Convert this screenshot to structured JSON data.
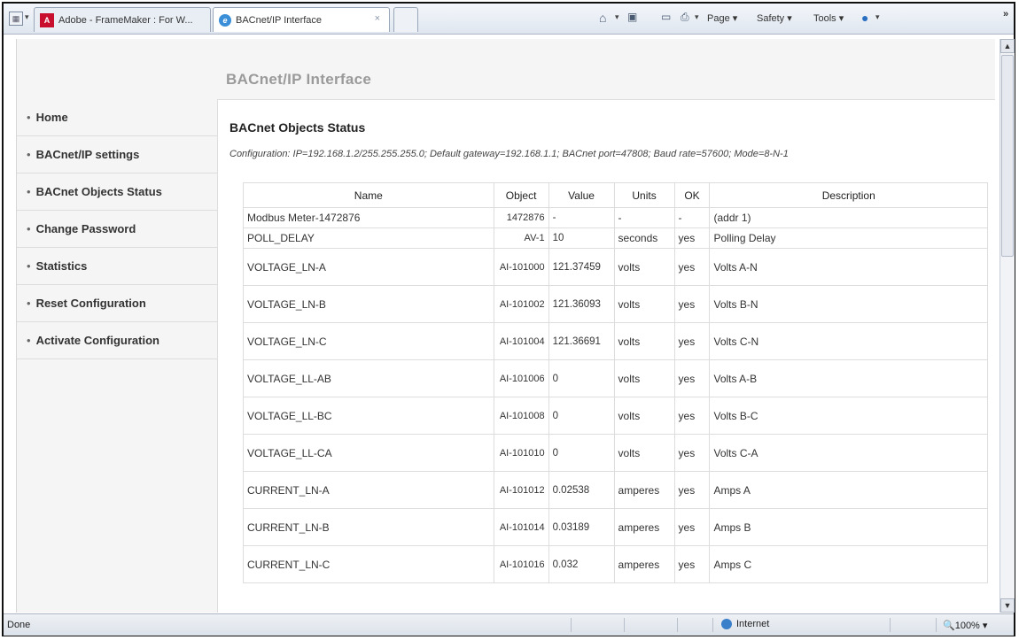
{
  "browser": {
    "tabs": [
      {
        "label": "Adobe - FrameMaker : For W..."
      },
      {
        "label": "BACnet/IP Interface",
        "close": "×"
      }
    ],
    "tabs_menu_glyph": "▾",
    "overflow_glyph": "»",
    "commands": {
      "page": "Page",
      "safety": "Safety",
      "tools": "Tools",
      "dropdown_glyph": "▾"
    },
    "status": {
      "text": "Done",
      "zone": "Internet",
      "zoom": "100%"
    }
  },
  "header": {
    "title": "BACnet/IP Interface"
  },
  "sidebar": {
    "bullet": "•",
    "items": [
      {
        "label": "Home"
      },
      {
        "label": "BACnet/IP settings"
      },
      {
        "label": "BACnet Objects Status"
      },
      {
        "label": "Change Password"
      },
      {
        "label": "Statistics"
      },
      {
        "label": "Reset Configuration"
      },
      {
        "label": "Activate Configuration"
      }
    ]
  },
  "main": {
    "title": "BACnet Objects Status",
    "configuration": "Configuration: IP=192.168.1.2/255.255.255.0; Default gateway=192.168.1.1; BACnet port=47808; Baud rate=57600; Mode=8-N-1",
    "columns": [
      "Name",
      "Object",
      "Value",
      "Units",
      "OK",
      "Description"
    ],
    "rows": [
      {
        "name": "Modbus Meter-1472876",
        "object": "1472876",
        "value": "-",
        "units": "-",
        "ok": "-",
        "description": "(addr 1)"
      },
      {
        "name": "POLL_DELAY",
        "object": "AV-1",
        "value": "10",
        "units": "seconds",
        "ok": "yes",
        "description": "Polling Delay"
      },
      {
        "name": "VOLTAGE_LN-A",
        "object": "AI-101000",
        "value": "121.37459",
        "units": "volts",
        "ok": "yes",
        "description": "Volts A-N"
      },
      {
        "name": "VOLTAGE_LN-B",
        "object": "AI-101002",
        "value": "121.36093",
        "units": "volts",
        "ok": "yes",
        "description": "Volts B-N"
      },
      {
        "name": "VOLTAGE_LN-C",
        "object": "AI-101004",
        "value": "121.36691",
        "units": "volts",
        "ok": "yes",
        "description": "Volts C-N"
      },
      {
        "name": "VOLTAGE_LL-AB",
        "object": "AI-101006",
        "value": "0",
        "units": "volts",
        "ok": "yes",
        "description": "Volts A-B"
      },
      {
        "name": "VOLTAGE_LL-BC",
        "object": "AI-101008",
        "value": "0",
        "units": "volts",
        "ok": "yes",
        "description": "Volts B-C"
      },
      {
        "name": "VOLTAGE_LL-CA",
        "object": "AI-101010",
        "value": "0",
        "units": "volts",
        "ok": "yes",
        "description": "Volts C-A"
      },
      {
        "name": "CURRENT_LN-A",
        "object": "AI-101012",
        "value": "0.02538",
        "units": "amperes",
        "ok": "yes",
        "description": "Amps A"
      },
      {
        "name": "CURRENT_LN-B",
        "object": "AI-101014",
        "value": "0.03189",
        "units": "amperes",
        "ok": "yes",
        "description": "Amps B"
      },
      {
        "name": "CURRENT_LN-C",
        "object": "AI-101016",
        "value": "0.032",
        "units": "amperes",
        "ok": "yes",
        "description": "Amps C"
      }
    ]
  }
}
